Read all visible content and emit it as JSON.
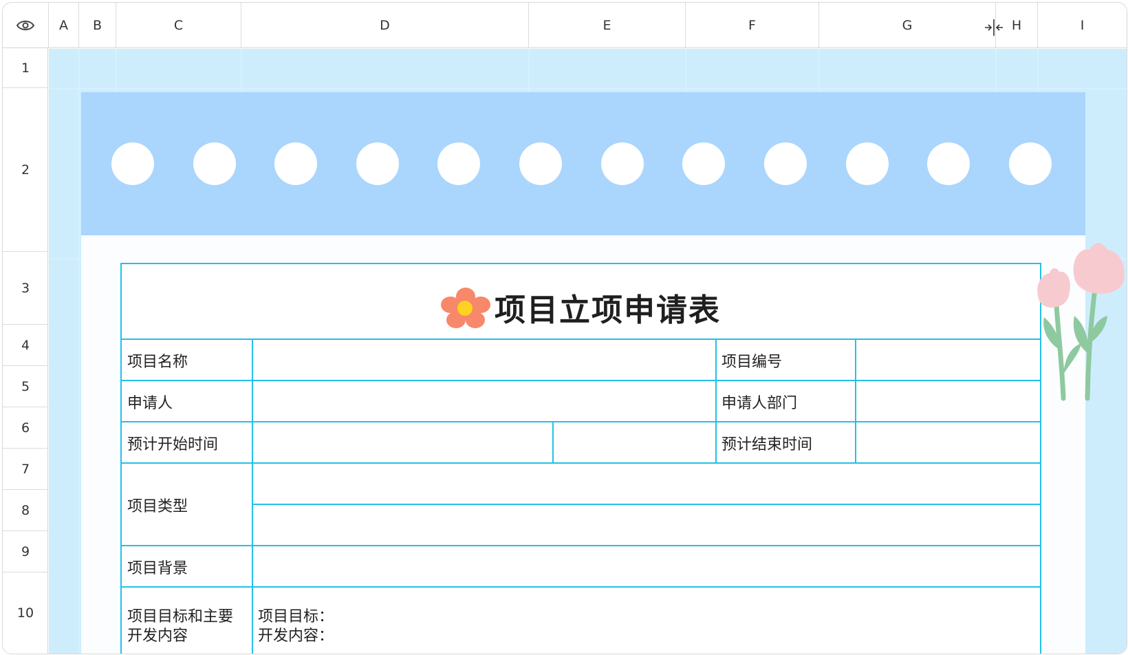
{
  "columns": [
    "A",
    "B",
    "C",
    "D",
    "E",
    "F",
    "G",
    "H",
    "I"
  ],
  "rows": [
    "1",
    "2",
    "3",
    "4",
    "5",
    "6",
    "7",
    "8",
    "9",
    "10"
  ],
  "corner_icon": "eye-icon",
  "resize_icon": "column-resize-icon",
  "banner": {
    "dot_count": 12,
    "band_color": "#aad5fd",
    "page_bg": "#cdedfd"
  },
  "form": {
    "title": "项目立项申请表",
    "title_icon": "flower-icon",
    "border_color": "#22c0e8",
    "labels": {
      "project_name": "项目名称",
      "project_number": "项目编号",
      "applicant": "申请人",
      "applicant_dept": "申请人部门",
      "planned_start": "预计开始时间",
      "planned_end": "预计结束时间",
      "project_type": "项目类型",
      "project_background": "项目背景",
      "goals_line1": "项目目标和主要",
      "goals_line2": "开发内容",
      "goal_field": "项目目标：",
      "content_field": "开发内容："
    }
  },
  "decoration": "tulip-illustration"
}
